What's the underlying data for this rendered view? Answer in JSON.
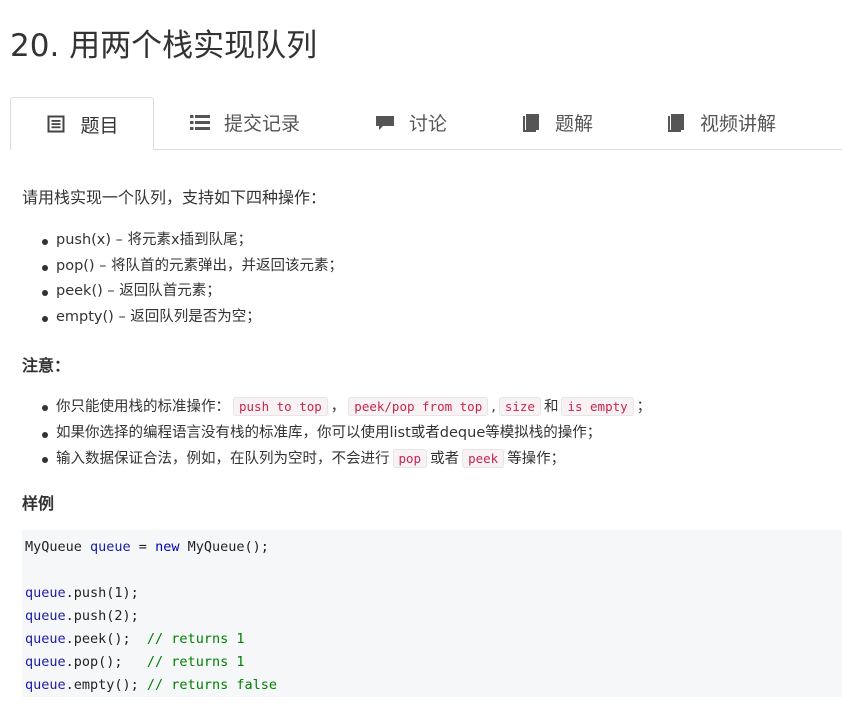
{
  "title": "20. 用两个栈实现队列",
  "tabs": [
    {
      "label": "题目",
      "icon": "document-list-icon",
      "active": true
    },
    {
      "label": "提交记录",
      "icon": "list-icon",
      "active": false
    },
    {
      "label": "讨论",
      "icon": "comment-icon",
      "active": false
    },
    {
      "label": "题解",
      "icon": "book-icon",
      "active": false
    },
    {
      "label": "视频讲解",
      "icon": "book-icon",
      "active": false
    }
  ],
  "problem": {
    "intro": "请用栈实现一个队列，支持如下四种操作：",
    "operations": [
      "push(x) – 将元素x插到队尾；",
      "pop() – 将队首的元素弹出，并返回该元素；",
      "peek() – 返回队首元素；",
      "empty() – 返回队列是否为空；"
    ],
    "notes_heading": "注意：",
    "notes": {
      "n1_prefix": "你只能使用栈的标准操作：",
      "n1_code1": "push to top",
      "n1_sep1": "，",
      "n1_code2": "peek/pop from top",
      "n1_sep2": ",",
      "n1_code3": "size",
      "n1_and": "和",
      "n1_code4": "is empty",
      "n1_end": "；",
      "n2": "如果你选择的编程语言没有栈的标准库，你可以使用list或者deque等模拟栈的操作；",
      "n3_prefix": "输入数据保证合法，例如，在队列为空时，不会进行",
      "n3_code1": "pop",
      "n3_or": "或者",
      "n3_code2": "peek",
      "n3_end": "等操作；"
    },
    "example_heading": "样例",
    "code": {
      "l1_a": "MyQueue ",
      "l1_var": "queue",
      "l1_b": " = ",
      "l1_kw": "new",
      "l1_c": " MyQueue();",
      "var": "queue",
      "l3": ".push(1);",
      "l4": ".push(2);",
      "l5": ".peek();  ",
      "l5_comment": "// returns 1",
      "l6": ".pop();   ",
      "l6_comment": "// returns 1",
      "l7": ".empty(); ",
      "l7_comment": "// returns false"
    }
  },
  "colors": {
    "inline_code_text": "#c7254e",
    "inline_code_bg": "#f9f2f4",
    "code_block_bg": "#f6f7f8",
    "code_var": "#1a1aa6",
    "code_keyword": "#0000c0",
    "code_comment": "#008000"
  }
}
